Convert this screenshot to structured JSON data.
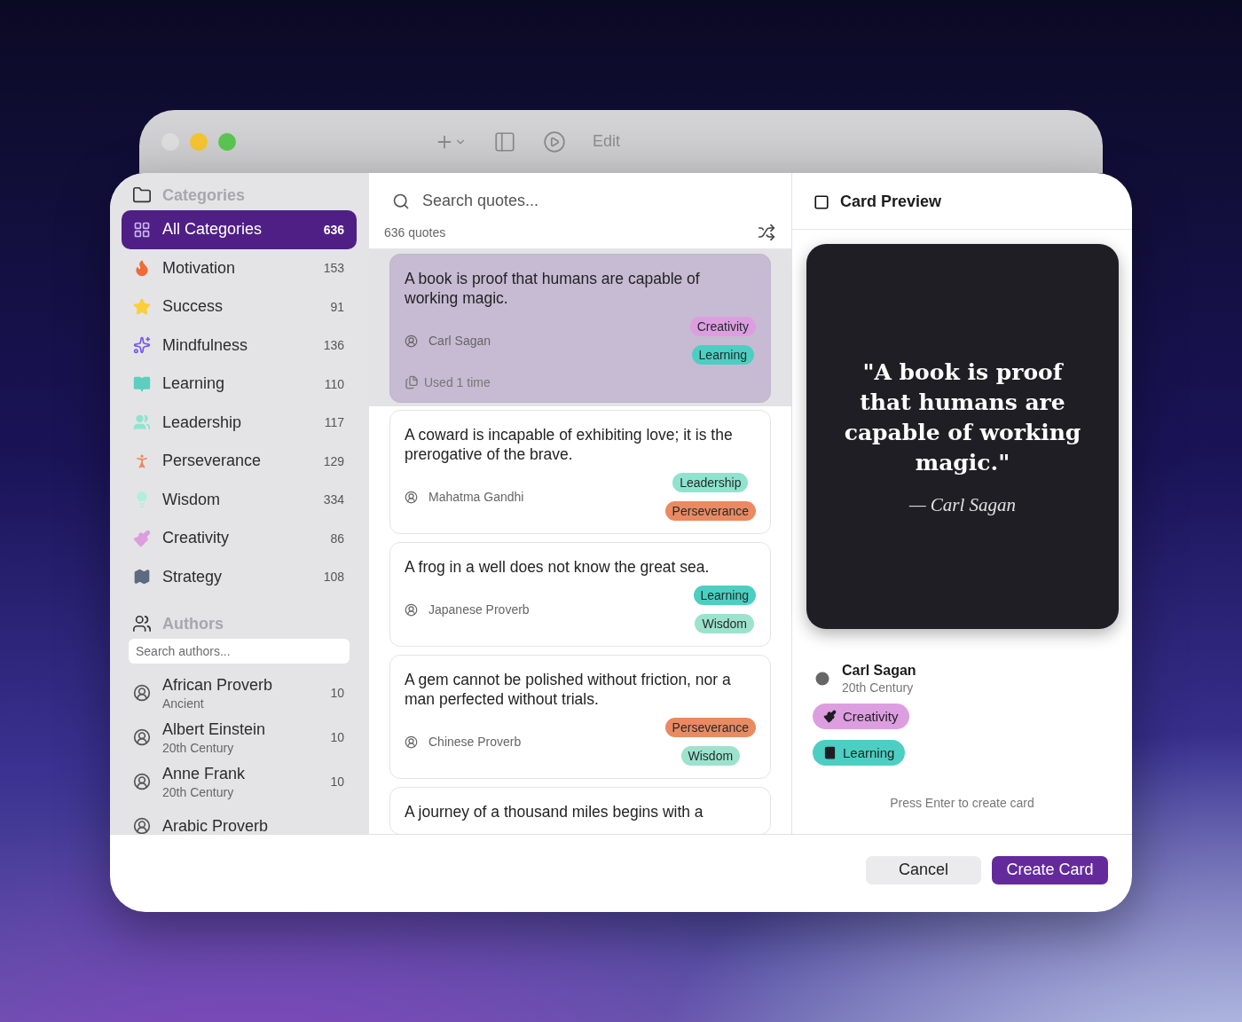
{
  "back_window": {
    "traffic_lights": [
      {
        "color": "#dddddd"
      },
      {
        "color": "#f4c430"
      },
      {
        "color": "#5ac552"
      }
    ],
    "toolbar_label": "Edit"
  },
  "sidebar": {
    "categories_title": "Categories",
    "categories": [
      {
        "label": "All Categories",
        "count": "636",
        "selected": true
      },
      {
        "label": "Motivation",
        "count": "153",
        "selected": false,
        "color": "#f06b35"
      },
      {
        "label": "Success",
        "count": "91",
        "selected": false,
        "color": "#f9cf3c"
      },
      {
        "label": "Mindfulness",
        "count": "136",
        "selected": false,
        "color": "#7656ee"
      },
      {
        "label": "Learning",
        "count": "110",
        "selected": false,
        "color": "#5ccfc0"
      },
      {
        "label": "Leadership",
        "count": "117",
        "selected": false,
        "color": "#8fe3cf"
      },
      {
        "label": "Perseverance",
        "count": "129",
        "selected": false,
        "color": "#ee8a5e"
      },
      {
        "label": "Wisdom",
        "count": "334",
        "selected": false,
        "color": "#b2eedb"
      },
      {
        "label": "Creativity",
        "count": "86",
        "selected": false,
        "color": "#dd9ee0"
      },
      {
        "label": "Strategy",
        "count": "108",
        "selected": false,
        "color": "#5d6b80"
      }
    ],
    "authors_title": "Authors",
    "author_search": {
      "placeholder": "Search authors..."
    },
    "authors": [
      {
        "name": "African Proverb",
        "era": "Ancient",
        "count": "10"
      },
      {
        "name": "Albert Einstein",
        "era": "20th Century",
        "count": "10"
      },
      {
        "name": "Anne Frank",
        "era": "20th Century",
        "count": "10"
      },
      {
        "name": "Arabic Proverb"
      }
    ]
  },
  "quotes": {
    "search": {
      "placeholder": "Search quotes..."
    },
    "count": "636 quotes",
    "items": [
      {
        "text": "A book is proof that humans are capable of working magic.",
        "author": "Carl Sagan",
        "selected": true,
        "usage": "Used 1 time",
        "tags": [
          {
            "label": "Creativity",
            "color": "#dd9ee0"
          },
          {
            "label": "Learning",
            "color": "#4ccfc2"
          }
        ]
      },
      {
        "text": "A coward is incapable of exhibiting love; it is the prerogative of the brave.",
        "author": "Mahatma Gandhi",
        "selected": false,
        "tags": [
          {
            "label": "Leadership",
            "color": "#8fe3cf"
          },
          {
            "label": "Perseverance",
            "color": "#e98a63"
          }
        ]
      },
      {
        "text": "A frog in a well does not know the great sea.",
        "author": "Japanese Proverb",
        "selected": false,
        "tags": [
          {
            "label": "Learning",
            "color": "#4ccfc2"
          },
          {
            "label": "Wisdom",
            "color": "#9de2cc"
          }
        ]
      },
      {
        "text": "A gem cannot be polished without friction, nor a man perfected without trials.",
        "author": "Chinese Proverb",
        "selected": false,
        "tags": [
          {
            "label": "Perseverance",
            "color": "#e98a63"
          },
          {
            "label": "Wisdom",
            "color": "#9de2cc"
          }
        ]
      },
      {
        "text": "A journey of a thousand miles begins with a",
        "selected": false
      }
    ]
  },
  "preview": {
    "title": "Card Preview",
    "quote": "\"A book is proof that humans are capable of working magic.\"",
    "attribution": "— Carl Sagan",
    "author": {
      "name": "Carl Sagan",
      "era": "20th Century"
    },
    "tags": [
      {
        "label": "Creativity",
        "color": "#dd9ee0"
      },
      {
        "label": "Learning",
        "color": "#4ccfc2"
      }
    ],
    "hint": "Press Enter to create card"
  },
  "buttons": [
    {
      "label": "Cancel",
      "kind": "secondary"
    },
    {
      "label": "Create Card",
      "kind": "primary"
    }
  ]
}
